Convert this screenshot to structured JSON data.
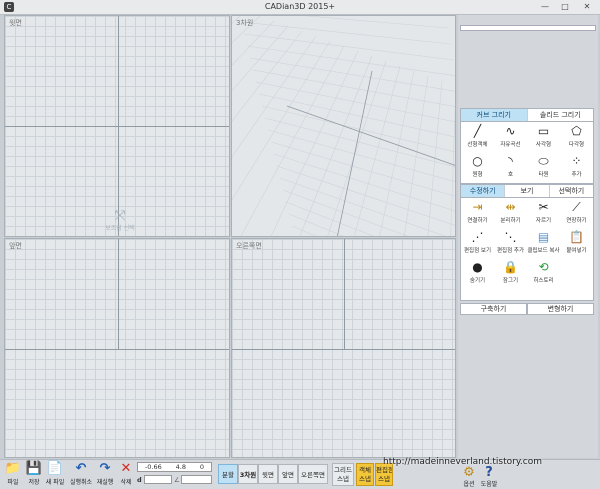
{
  "window": {
    "title": "CADian3D 2015+",
    "app_icon": "C",
    "min_glyph": "—",
    "max_glyph": "□",
    "close_glyph": "✕"
  },
  "viewports": {
    "top_label": "윗면",
    "3d_label": "3차원",
    "front_label": "앞면",
    "right_label": "오른쪽면",
    "hint_icon": "⤧",
    "hint_text": "보조점 선택"
  },
  "panel": {
    "draw_tabs": [
      "커브 그리기",
      "솔리드 그리기"
    ],
    "draw_tools": [
      {
        "icon": "╱",
        "label": "선형객체"
      },
      {
        "icon": "∿",
        "label": "자유곡선"
      },
      {
        "icon": "▭",
        "label": "사각형"
      },
      {
        "icon": "⬠",
        "label": "다각형"
      },
      {
        "icon": "○",
        "label": "원형"
      },
      {
        "icon": "◝",
        "label": "호"
      },
      {
        "icon": "⬭",
        "label": "타원"
      },
      {
        "icon": "⁘",
        "label": "추가"
      }
    ],
    "edit_tabs": [
      "수정하기",
      "보기",
      "선택하기"
    ],
    "edit_tools": [
      {
        "icon": "⇥",
        "label": "연결하기"
      },
      {
        "icon": "⇹",
        "label": "분리하기"
      },
      {
        "icon": "✂",
        "label": "자르기"
      },
      {
        "icon": "⟋",
        "label": "연장하기"
      },
      {
        "icon": "⋰",
        "label": "편집점 보기"
      },
      {
        "icon": "⋱",
        "label": "편집점 추가"
      },
      {
        "icon": "▤",
        "label": "클립보드 복사"
      },
      {
        "icon": "📋",
        "label": "붙여넣기"
      },
      {
        "icon": "●",
        "label": "숨기기"
      },
      {
        "icon": "🔒",
        "label": "잠그기"
      },
      {
        "icon": "⟲",
        "label": "히스토리"
      }
    ],
    "build_label": "구축하기",
    "transform_label": "변형하기"
  },
  "statusbar": {
    "file": {
      "icon": "📁",
      "label": "파일"
    },
    "save": {
      "icon": "💾",
      "label": "저장"
    },
    "new_file": {
      "icon": "📄",
      "label": "새 파일"
    },
    "undo": {
      "icon": "↶",
      "label": "실행취소"
    },
    "redo": {
      "icon": "↷",
      "label": "재실행"
    },
    "delete": {
      "icon": "✕",
      "label": "삭제"
    },
    "coord_x": "-0.66",
    "coord_y": "4.8",
    "coord_z": "0",
    "dist_label": "d",
    "angle_label": "∠",
    "view_split": "분할",
    "view_3d": "3차원",
    "view_top": "윗면",
    "view_front": "앞면",
    "view_right": "오른쪽면",
    "grid_snap": "그리드\n스냅",
    "obj_snap": "객체\n스냅",
    "edit_snap": "편집점\n스냅",
    "options": {
      "icon": "⚙",
      "label": "옵션"
    },
    "help": {
      "icon": "?",
      "label": "도움말"
    },
    "watermark": "http://madeinneverland.tistory.com"
  },
  "colors": {
    "accent": "#bfe1f5",
    "delete_red": "#d52a1e",
    "undo_blue": "#1f5fb3",
    "snap_yellow": "#f3c63a",
    "viewport_bg": "#e4e8eb"
  }
}
